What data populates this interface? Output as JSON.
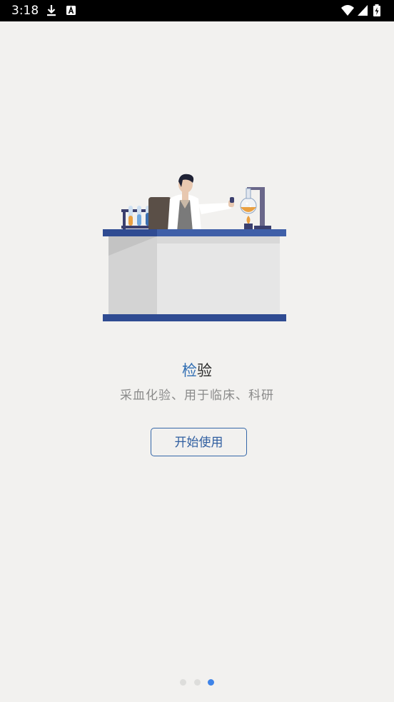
{
  "status_bar": {
    "time": "3:18",
    "left_icons": [
      "download-icon",
      "a-notification-icon"
    ],
    "right_icons": [
      "wifi-icon",
      "signal-icon",
      "battery-charging-icon"
    ]
  },
  "onboarding": {
    "illustration": "doctor-at-lab-bench-illustration",
    "title_first_char": "检",
    "title_rest": "验",
    "subtitle": "采血化验、用于临床、科研",
    "start_button_label": "开始使用"
  },
  "pager": {
    "page_count": 3,
    "current_page": 3
  },
  "colors": {
    "background": "#f2f1ef",
    "accent": "#2f6db2",
    "button_border": "#3567a8",
    "dot_active": "#3f84e8",
    "dot_inactive": "#dddddb"
  }
}
